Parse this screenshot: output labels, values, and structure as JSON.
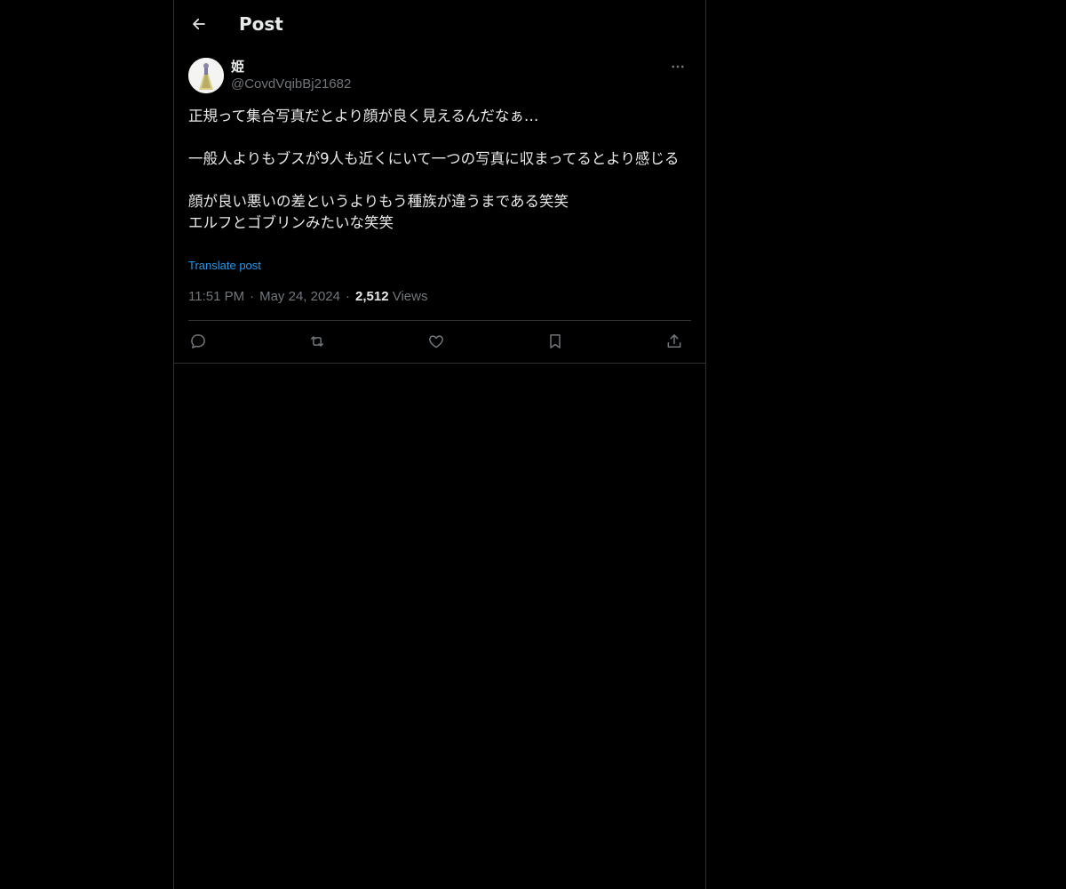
{
  "header": {
    "title": "Post",
    "back_icon": "arrow-left-icon"
  },
  "post": {
    "author": {
      "name": "姫",
      "handle": "@CovdVqibBj21682"
    },
    "more_icon": "more-horizontal-icon",
    "text": "正規って集合写真だとより顔が良く見えるんだなぁ…\n\n一般人よりもブスが9人も近くにいて一つの写真に収まってるとより感じる\n\n顔が良い悪いの差というよりもう種族が違うまである笑笑\nエルフとゴブリンみたいな笑笑",
    "translate_label": "Translate post",
    "time": "11:51 PM",
    "date": "May 24, 2024",
    "views_count": "2,512",
    "views_label": "Views",
    "separator": "·"
  },
  "actions": [
    {
      "name": "reply",
      "icon": "reply-icon"
    },
    {
      "name": "repost",
      "icon": "repost-icon"
    },
    {
      "name": "like",
      "icon": "heart-icon"
    },
    {
      "name": "bookmark",
      "icon": "bookmark-icon"
    },
    {
      "name": "share",
      "icon": "share-icon"
    }
  ],
  "colors": {
    "background": "#000000",
    "text": "#e7e9ea",
    "secondary": "#71767b",
    "link": "#1d9bf0",
    "border": "#2f3336"
  }
}
